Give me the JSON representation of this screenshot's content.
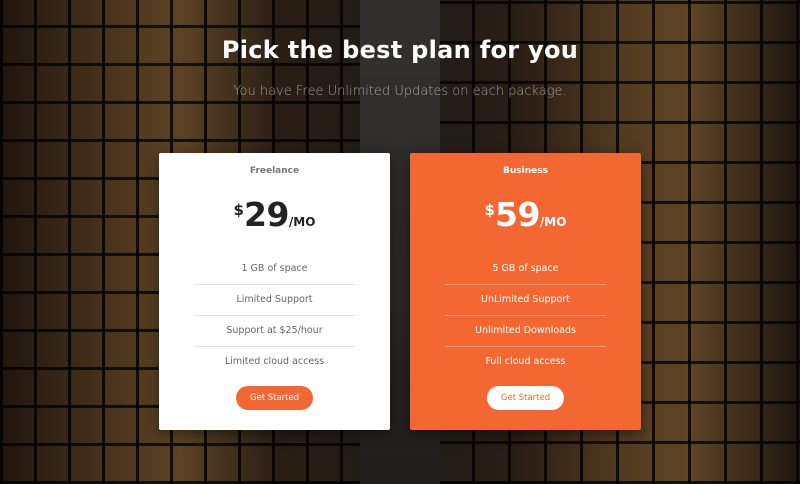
{
  "header": {
    "title": "Pick the best plan for you",
    "subtitle": "You have Free Unlimited Updates on each package."
  },
  "plans": [
    {
      "name": "Freelance",
      "currency": "$",
      "amount": "29",
      "period": "/MO",
      "features": [
        "1 GB of space",
        "Limited Support",
        "Support at $25/hour",
        "Limited cloud access"
      ],
      "cta": "Get Started"
    },
    {
      "name": "Business",
      "currency": "$",
      "amount": "59",
      "period": "/MO",
      "features": [
        "5 GB of space",
        "UnLimited Support",
        "Unlimited Downloads",
        "Full cloud access"
      ],
      "cta": "Get Started"
    }
  ],
  "colors": {
    "accent": "#f26732",
    "card_light": "#ffffff"
  }
}
